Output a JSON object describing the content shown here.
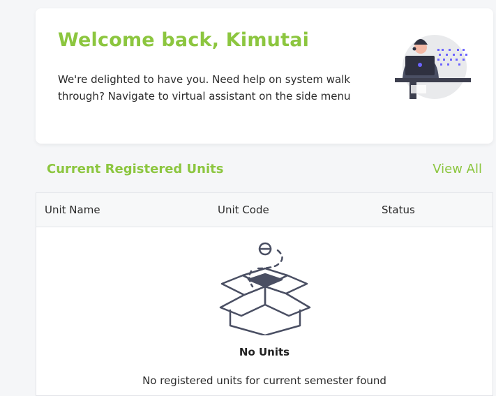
{
  "welcome": {
    "title": "Welcome back, Kimutai",
    "message": "We're delighted to have you. Need help on system walk through? Navigate to virtual assistant on the side menu"
  },
  "units": {
    "section_title": "Current Registered Units",
    "view_all_label": "View All",
    "columns": [
      "Unit Name",
      "Unit Code",
      "Status"
    ],
    "empty_title": "No Units",
    "empty_message": "No registered units for current semester found"
  },
  "colors": {
    "accent": "#8cc63f",
    "icon": "#4a4f63"
  }
}
